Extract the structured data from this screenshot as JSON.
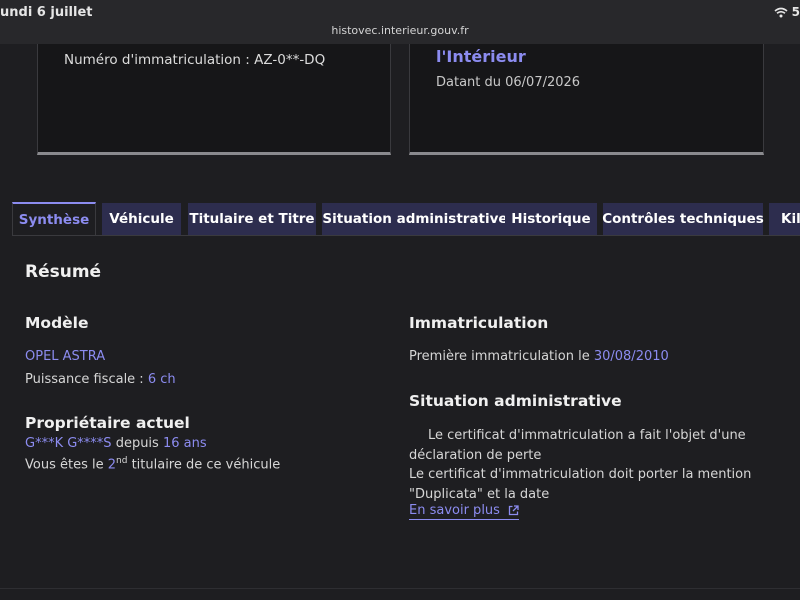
{
  "status_bar": {
    "time": "undi 6 juillet",
    "battery": "5",
    "url": "histovec.interieur.gouv.fr"
  },
  "cards": {
    "plate_label": "Numéro d'immatriculation : AZ-0**-DQ",
    "ministry": "l'Intérieur",
    "dated": "Datant du 06/07/2026"
  },
  "tabs": [
    {
      "label": "Synthèse",
      "active": true
    },
    {
      "label": "Véhicule"
    },
    {
      "label": "Titulaire et Titre"
    },
    {
      "label": "Situation administrative"
    },
    {
      "label": "Historique"
    },
    {
      "label": "Contrôles techniques"
    },
    {
      "label": "Kil"
    }
  ],
  "summary": {
    "title": "Résumé",
    "model": {
      "heading": "Modèle",
      "name": "OPEL ASTRA",
      "power_label": "Puissance fiscale : ",
      "power_value": "6 ch"
    },
    "owner": {
      "heading": "Propriétaire actuel",
      "name": "G***K G****S",
      "since_label": " depuis ",
      "since_value": "16 ans",
      "rank_prefix": "Vous êtes le ",
      "rank_num": "2",
      "rank_sup": "nd",
      "rank_suffix": " titulaire de ce véhicule"
    },
    "registration": {
      "heading": "Immatriculation",
      "first_label": "Première immatriculation le ",
      "first_date": "30/08/2010"
    },
    "admin": {
      "heading": "Situation administrative",
      "text1": "Le certificat d'immatriculation a fait l'objet d'une déclaration de perte",
      "text2": "Le certificat d'immatriculation doit porter la mention \"Duplicata\" et la date",
      "link": "En savoir plus"
    }
  },
  "colors": {
    "accent": "#8c8cf0",
    "tab_bg": "#2d2d4e",
    "background": "#1e1e21"
  }
}
